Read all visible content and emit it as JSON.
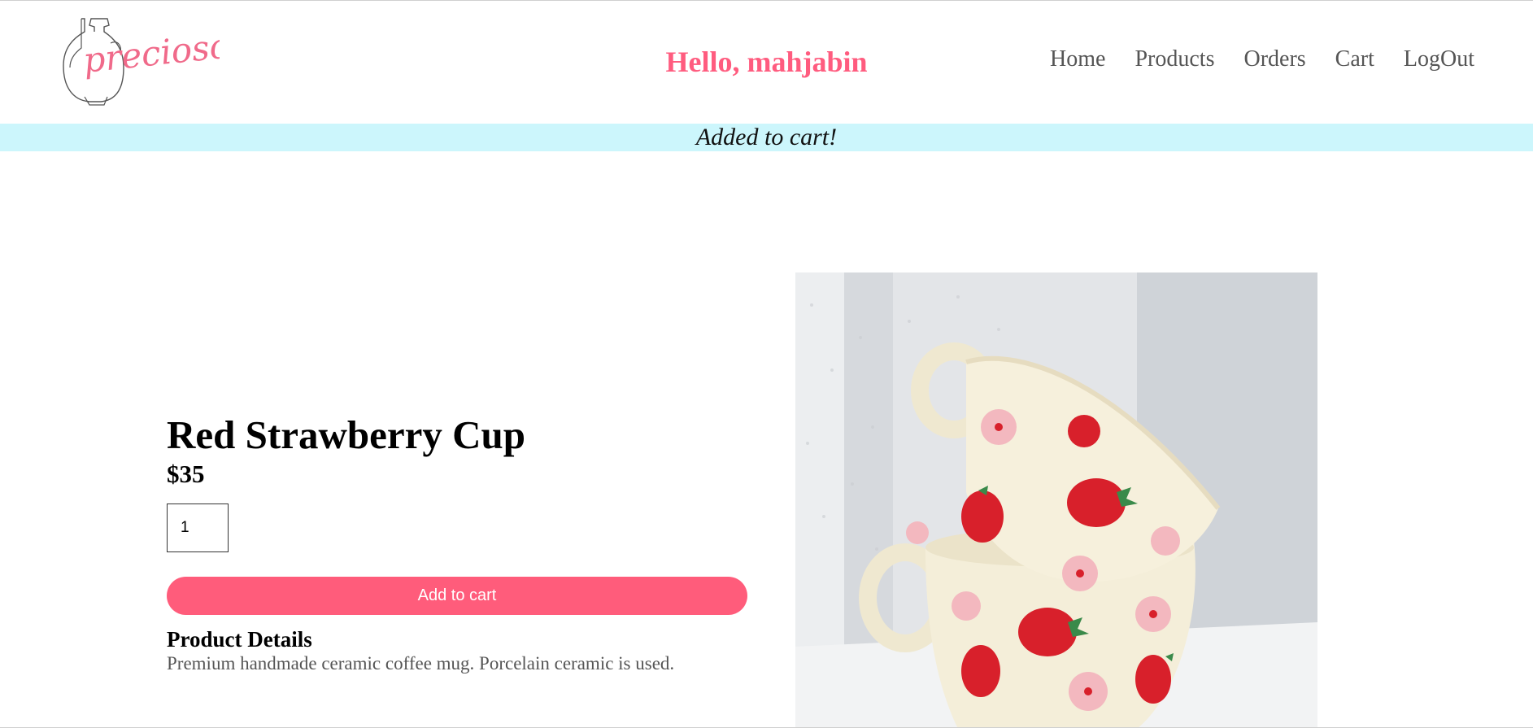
{
  "header": {
    "logo_text": "precioso",
    "greeting": "Hello, mahjabin",
    "nav": [
      "Home",
      "Products",
      "Orders",
      "Cart",
      "LogOut"
    ]
  },
  "banner": {
    "message": "Added to cart!"
  },
  "product": {
    "title": "Red Strawberry Cup",
    "price": "$35",
    "quantity": "1",
    "add_button": "Add to cart",
    "details_heading": "Product Details",
    "details_text": "Premium handmade ceramic coffee mug. Porcelain ceramic is used.",
    "image_icon": "strawberry-mug-image"
  },
  "colors": {
    "brand_pink": "#ff5c7f",
    "banner_bg": "#ccf6fc",
    "nav_text": "#555555"
  }
}
